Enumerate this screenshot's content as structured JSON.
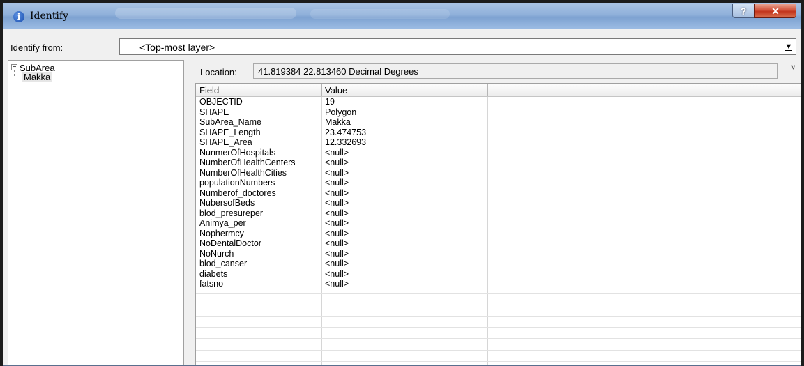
{
  "window": {
    "title": "Identify",
    "help_label": "?",
    "close_label": "✕"
  },
  "identify_from": {
    "label": "Identify from:",
    "value": "<Top-most layer>"
  },
  "tree": {
    "root": "SubArea",
    "child": "Makka"
  },
  "location": {
    "label": "Location:",
    "value": "41.819384  22.813460 Decimal Degrees"
  },
  "grid": {
    "headers": [
      "Field",
      "Value"
    ],
    "rows": [
      {
        "field": "OBJECTID",
        "value": "19"
      },
      {
        "field": "SHAPE",
        "value": "Polygon"
      },
      {
        "field": "SubArea_Name",
        "value": "Makka"
      },
      {
        "field": "SHAPE_Length",
        "value": "23.474753"
      },
      {
        "field": "SHAPE_Area",
        "value": "12.332693"
      },
      {
        "field": "NunmerOfHospitals",
        "value": "<null>"
      },
      {
        "field": "NumberOfHealthCenters",
        "value": "<null>"
      },
      {
        "field": "NumberOfHealthCities",
        "value": "<null>"
      },
      {
        "field": "populationNumbers",
        "value": "<null>"
      },
      {
        "field": "Numberof_doctores",
        "value": "<null>"
      },
      {
        "field": "NubersofBeds",
        "value": "<null>"
      },
      {
        "field": "blod_presureper",
        "value": "<null>"
      },
      {
        "field": "Animya_per",
        "value": "<null>"
      },
      {
        "field": "Nophermcy",
        "value": "<null>"
      },
      {
        "field": "NoDentalDoctor",
        "value": "<null>"
      },
      {
        "field": "NoNurch",
        "value": "<null>"
      },
      {
        "field": "blod_canser",
        "value": "<null>"
      },
      {
        "field": "diabets",
        "value": "<null>"
      },
      {
        "field": "fatsno",
        "value": "<null>"
      }
    ]
  }
}
